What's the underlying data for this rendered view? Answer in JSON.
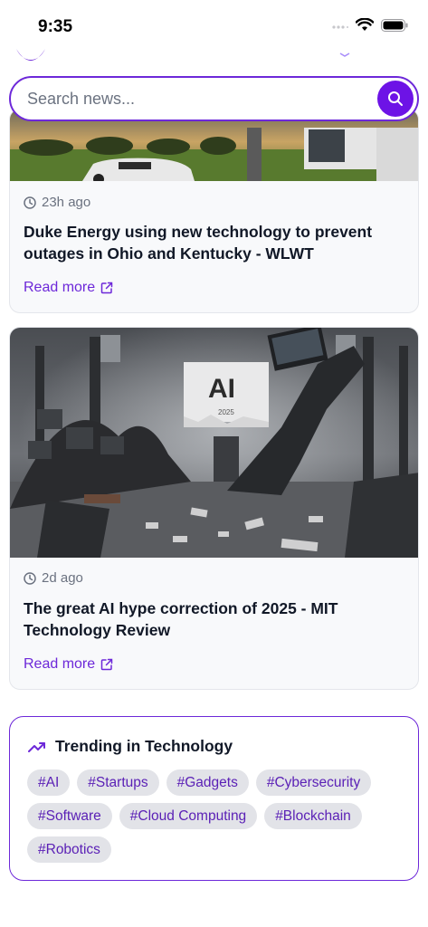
{
  "status_bar": {
    "time": "9:35"
  },
  "search": {
    "placeholder": "Search news..."
  },
  "articles": [
    {
      "time_ago": "23h ago",
      "title": "Duke Energy using new technology to prevent outages in Ohio and Kentucky - WLWT",
      "read_more": "Read more"
    },
    {
      "time_ago": "2d ago",
      "title": "The great AI hype correction of 2025 - MIT Technology Review",
      "read_more": "Read more",
      "image_text": "AI",
      "image_subtext": "2025"
    }
  ],
  "trending": {
    "title": "Trending in Technology",
    "tags": [
      "#AI",
      "#Startups",
      "#Gadgets",
      "#Cybersecurity",
      "#Software",
      "#Cloud Computing",
      "#Blockchain",
      "#Robotics"
    ]
  },
  "colors": {
    "accent": "#6d28d9",
    "button": "#6d13e6",
    "tag_bg": "#e2e3e8"
  },
  "icons": [
    "wifi-icon",
    "battery-icon",
    "search-icon",
    "clock-icon",
    "external-link-icon",
    "trending-up-icon"
  ]
}
